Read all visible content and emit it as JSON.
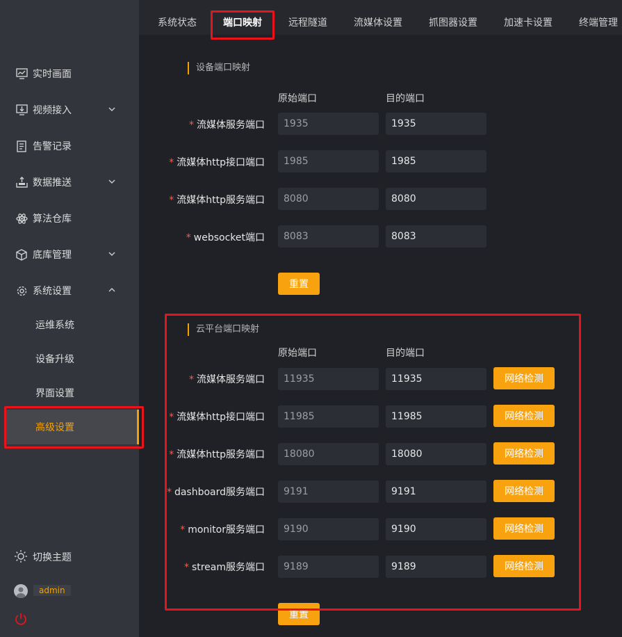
{
  "tabs": [
    {
      "label": "系统状态",
      "active": false
    },
    {
      "label": "端口映射",
      "active": true
    },
    {
      "label": "远程隧道",
      "active": false
    },
    {
      "label": "流媒体设置",
      "active": false
    },
    {
      "label": "抓图器设置",
      "active": false
    },
    {
      "label": "加速卡设置",
      "active": false
    },
    {
      "label": "终端管理",
      "active": false
    }
  ],
  "sidebar": {
    "items": [
      {
        "label": "实时画面",
        "icon": "chart-monitor-icon"
      },
      {
        "label": "视频接入",
        "icon": "monitor-download-icon",
        "expandable": true
      },
      {
        "label": "告警记录",
        "icon": "document-list-icon"
      },
      {
        "label": "数据推送",
        "icon": "upload-tray-icon",
        "expandable": true
      },
      {
        "label": "算法仓库",
        "icon": "atom-icon"
      },
      {
        "label": "底库管理",
        "icon": "cube-icon",
        "expandable": true
      },
      {
        "label": "系统设置",
        "icon": "gear-icon",
        "expandable": true,
        "expanded": true
      }
    ],
    "sub_items": [
      {
        "label": "运维系统",
        "active": false
      },
      {
        "label": "设备升级",
        "active": false
      },
      {
        "label": "界面设置",
        "active": false
      },
      {
        "label": "高级设置",
        "active": true
      }
    ],
    "theme_label": "切换主题",
    "username": "admin"
  },
  "device_section": {
    "title": "设备端口映射",
    "col_src": "原始端口",
    "col_dst": "目的端口",
    "rows": [
      {
        "label": "流媒体服务端口",
        "src": "1935",
        "dst": "1935"
      },
      {
        "label": "流媒体http接口端口",
        "src": "1985",
        "dst": "1985"
      },
      {
        "label": "流媒体http服务端口",
        "src": "8080",
        "dst": "8080"
      },
      {
        "label": "websocket端口",
        "src": "8083",
        "dst": "8083"
      }
    ],
    "reset_label": "重置"
  },
  "cloud_section": {
    "title": "云平台端口映射",
    "col_src": "原始端口",
    "col_dst": "目的端口",
    "rows": [
      {
        "label": "流媒体服务端口",
        "src": "11935",
        "dst": "11935"
      },
      {
        "label": "流媒体http接口端口",
        "src": "11985",
        "dst": "11985"
      },
      {
        "label": "流媒体http服务端口",
        "src": "18080",
        "dst": "18080"
      },
      {
        "label": "dashboard服务端口",
        "src": "9191",
        "dst": "9191"
      },
      {
        "label": "monitor服务端口",
        "src": "9190",
        "dst": "9190"
      },
      {
        "label": "stream服务端口",
        "src": "9189",
        "dst": "9189"
      }
    ],
    "check_label": "网络检测",
    "reset_label": "重置"
  },
  "colors": {
    "accent": "#f7a20e",
    "highlight": "#e8131b",
    "background": "#1f2126",
    "sidebar": "#32353c"
  }
}
